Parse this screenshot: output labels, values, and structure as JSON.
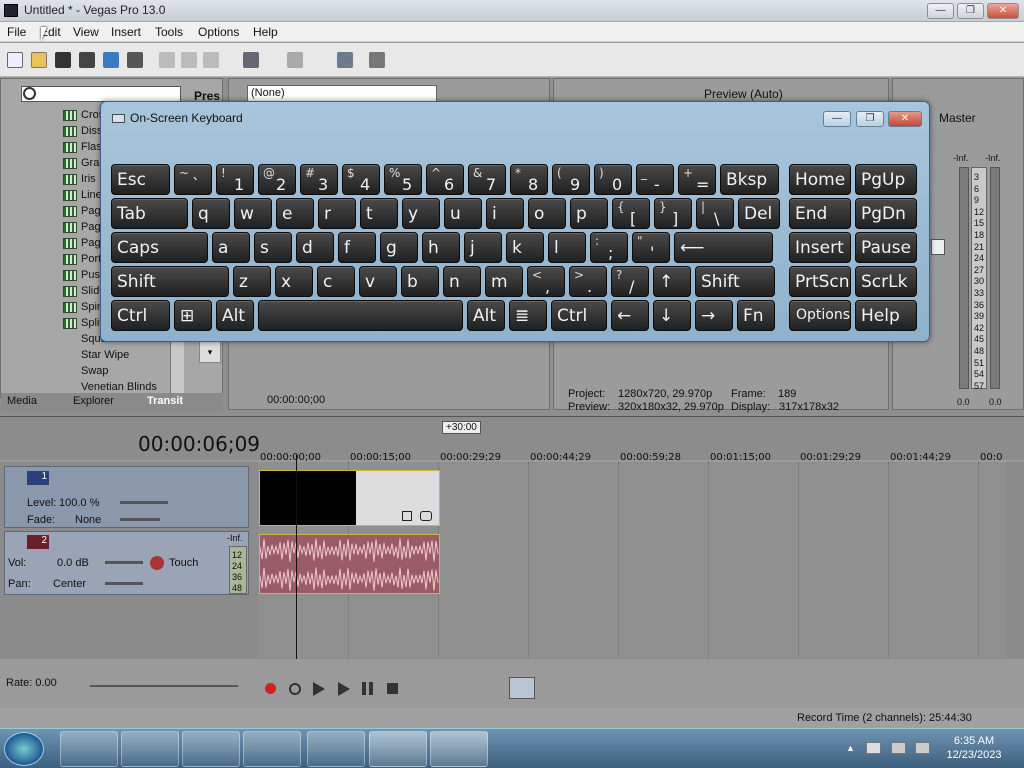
{
  "window": {
    "title": "Untitled * - Vegas Pro 13.0",
    "min": "—",
    "max": "❐",
    "close": "✕"
  },
  "menu": [
    "File",
    "Edit",
    "View",
    "Insert",
    "Tools",
    "Options",
    "Help"
  ],
  "explorer": {
    "items": [
      "Cros",
      "Diss",
      "Flas",
      "Grad",
      "Iris",
      "Line",
      "Pag",
      "Pag",
      "Pag",
      "Port",
      "Push",
      "Slide",
      "Spin",
      "Split",
      "Squeeze",
      "Star Wipe",
      "Swap",
      "Venetian Blinds"
    ],
    "pres_label": "Pres",
    "tabs": [
      "Media",
      "Explorer",
      "Transit"
    ]
  },
  "preview": {
    "preset_value": "(None)",
    "quality": "Preview (Auto)",
    "project_label": "Project:",
    "project_value": "1280x720, 29.970p",
    "preview_label": "Preview:",
    "preview_value": "320x180x32, 29.970p",
    "frame_label": "Frame:",
    "frame_value": "189",
    "display_label": "Display:",
    "display_value": "317x178x32",
    "trimmer_time": "00:00:00;00"
  },
  "master": {
    "label": "Master",
    "left_inf": "-Inf.",
    "right_inf": "-Inf.",
    "scale": [
      "3",
      "6",
      "9",
      "12",
      "15",
      "18",
      "21",
      "24",
      "27",
      "30",
      "33",
      "36",
      "39",
      "42",
      "45",
      "48",
      "51",
      "54",
      "57"
    ],
    "left_db": "0.0",
    "right_db": "0.0"
  },
  "osk": {
    "title": "On-Screen Keyboard",
    "rows": [
      [
        {
          "main": "Esc"
        },
        {
          "sub": "~",
          "main": "`"
        },
        {
          "sub": "!",
          "main": "1"
        },
        {
          "sub": "@",
          "main": "2"
        },
        {
          "sub": "#",
          "main": "3"
        },
        {
          "sub": "$",
          "main": "4"
        },
        {
          "sub": "%",
          "main": "5"
        },
        {
          "sub": "^",
          "main": "6"
        },
        {
          "sub": "&",
          "main": "7"
        },
        {
          "sub": "*",
          "main": "8"
        },
        {
          "sub": "(",
          "main": "9"
        },
        {
          "sub": ")",
          "main": "0"
        },
        {
          "sub": "_",
          "main": "-"
        },
        {
          "sub": "+",
          "main": "="
        },
        {
          "main": "Bksp"
        },
        {
          "main": "Home"
        },
        {
          "main": "PgUp"
        }
      ],
      [
        {
          "main": "Tab"
        },
        {
          "main": "q"
        },
        {
          "main": "w"
        },
        {
          "main": "e"
        },
        {
          "main": "r"
        },
        {
          "main": "t"
        },
        {
          "main": "y"
        },
        {
          "main": "u"
        },
        {
          "main": "i"
        },
        {
          "main": "o"
        },
        {
          "main": "p"
        },
        {
          "sub": "{",
          "main": "["
        },
        {
          "sub": "}",
          "main": "]"
        },
        {
          "sub": "|",
          "main": "\\"
        },
        {
          "main": "Del"
        },
        {
          "main": "End"
        },
        {
          "main": "PgDn"
        }
      ],
      [
        {
          "main": "Caps"
        },
        {
          "main": "a"
        },
        {
          "main": "s"
        },
        {
          "main": "d"
        },
        {
          "main": "f"
        },
        {
          "main": "g"
        },
        {
          "main": "h"
        },
        {
          "main": "j"
        },
        {
          "main": "k"
        },
        {
          "main": "l"
        },
        {
          "sub": ":",
          "main": ";"
        },
        {
          "sub": "\"",
          "main": "'"
        },
        {
          "main": "⟵"
        },
        {
          "main": "Insert"
        },
        {
          "main": "Pause"
        }
      ],
      [
        {
          "main": "Shift"
        },
        {
          "main": "z"
        },
        {
          "main": "x"
        },
        {
          "main": "c"
        },
        {
          "main": "v"
        },
        {
          "main": "b"
        },
        {
          "main": "n"
        },
        {
          "main": "m"
        },
        {
          "sub": "<",
          "main": ","
        },
        {
          "sub": ">",
          "main": "."
        },
        {
          "sub": "?",
          "main": "/"
        },
        {
          "main": "↑"
        },
        {
          "main": "Shift"
        },
        {
          "main": "PrtScn"
        },
        {
          "main": "ScrLk"
        }
      ],
      [
        {
          "main": "Ctrl"
        },
        {
          "main": "⊞"
        },
        {
          "main": "Alt"
        },
        {
          "main": ""
        },
        {
          "main": "Alt"
        },
        {
          "main": "≣"
        },
        {
          "main": "Ctrl"
        },
        {
          "main": "←"
        },
        {
          "main": "↓"
        },
        {
          "main": "→"
        },
        {
          "main": "Fn"
        },
        {
          "main": "Options"
        },
        {
          "main": "Help"
        }
      ]
    ]
  },
  "timeline": {
    "timecode": "00:00:06;09",
    "region_end": "+30:00",
    "ruler": [
      "00:00:00;00",
      "00:00:15;00",
      "00:00:29;29",
      "00:00:44;29",
      "00:00:59;28",
      "00:01:15;00",
      "00:01:29;29",
      "00:01:44;29",
      "00:0"
    ]
  },
  "video_track": {
    "number": "1",
    "level_label": "Level:",
    "level_value": "100.0 %",
    "fade_label": "Fade:",
    "fade_value": "None"
  },
  "audio_track": {
    "number": "2",
    "vol_label": "Vol:",
    "vol_value": "0.0 dB",
    "pan_label": "Pan:",
    "pan_value": "Center",
    "mode": "Touch",
    "meter_inf": "-Inf.",
    "meter_scale": [
      "12",
      "24",
      "36",
      "48"
    ]
  },
  "transport": {
    "rate_label": "Rate: 0.00"
  },
  "status": {
    "record_time": "Record Time (2 channels): 25:44:30"
  },
  "taskbar": {
    "time": "6:35 AM",
    "date": "12/23/2023"
  }
}
